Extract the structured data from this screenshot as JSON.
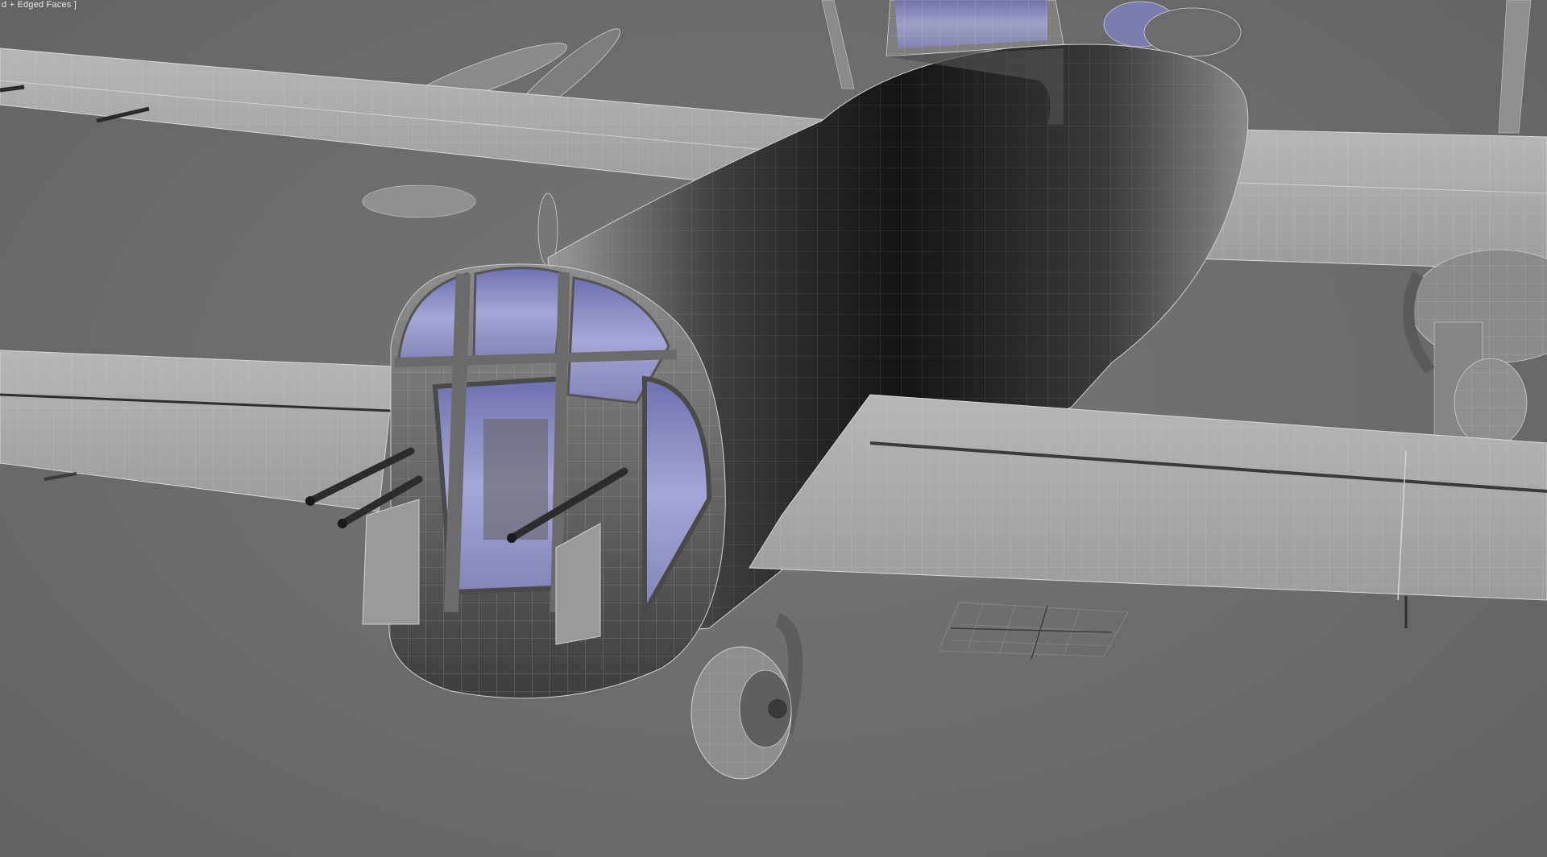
{
  "viewport": {
    "label": "d + Edged Faces ]"
  },
  "colors": {
    "background": "#6e6e6e",
    "wing_fill": "#a9a9a9",
    "fuselage_dark": "#1e1e1e",
    "fuselage_light": "#8c8c8c",
    "canopy_glass": "#8d8fc9",
    "wire": "#d0d0d0"
  },
  "icons": [
    "viewport-gizmo-icon"
  ]
}
